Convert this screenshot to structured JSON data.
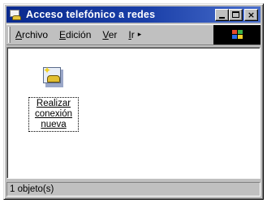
{
  "window": {
    "title": "Acceso telefónico a redes",
    "controls": {
      "minimize": "",
      "maximize": "",
      "close": "×"
    }
  },
  "menu": {
    "items": [
      {
        "label": "Archivo",
        "accel_index": 0
      },
      {
        "label": "Edición",
        "accel_index": 0
      },
      {
        "label": "Ver",
        "accel_index": 0
      },
      {
        "label": "Ir",
        "accel_index": 0
      }
    ],
    "more_indicator": "▸"
  },
  "content": {
    "items": [
      {
        "label_lines": [
          "Realizar",
          "conexión",
          "nueva"
        ],
        "icon": "new-connection-icon",
        "selected": true
      }
    ]
  },
  "status": {
    "text": "1 objeto(s)"
  },
  "colors": {
    "titlebar": "#0a2a8e",
    "face": "#c0c0c0",
    "content_bg": "#ffffff"
  }
}
